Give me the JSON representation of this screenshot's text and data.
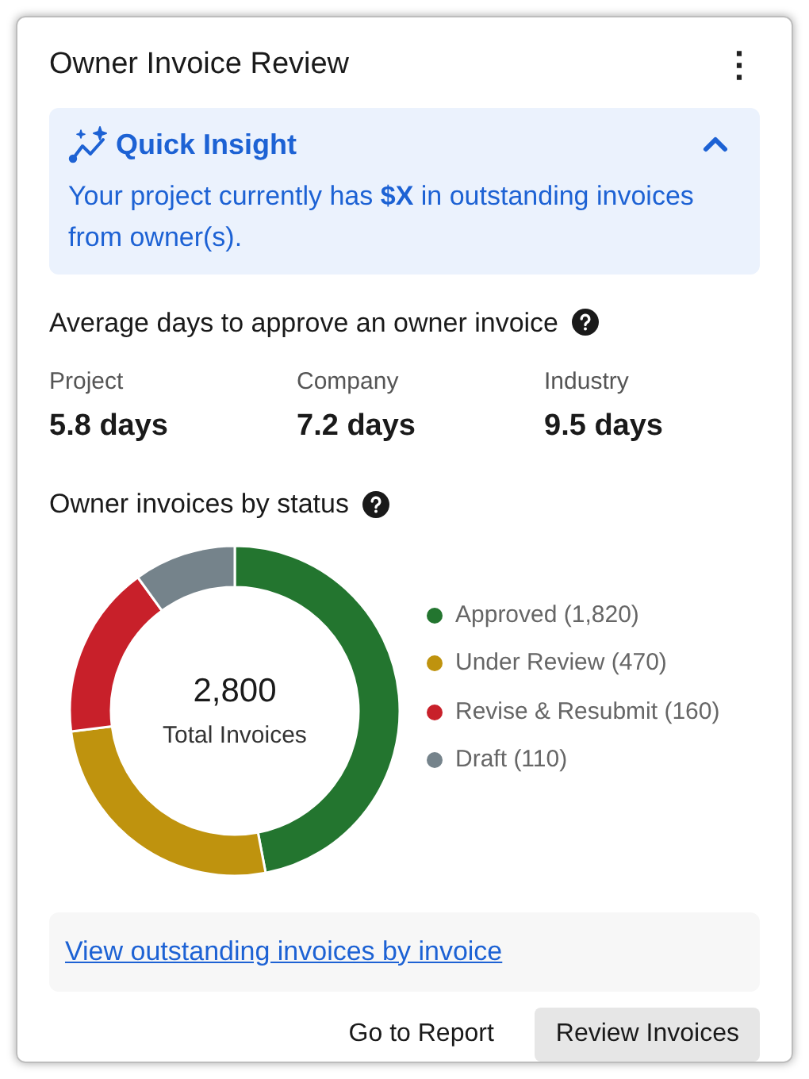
{
  "card": {
    "title": "Owner Invoice Review",
    "menu_icon": "⋮"
  },
  "insight": {
    "title": "Quick Insight",
    "expanded": true,
    "text": "Your project currently has **$X** in outstanding invoices from owner(s)."
  },
  "average": {
    "title": "Average days to approve an owner invoice",
    "stats": [
      {
        "label": "Project",
        "value": "5.8 days"
      },
      {
        "label": "Company",
        "value": "7.2 days"
      },
      {
        "label": "Industry",
        "value": "9.5 days"
      }
    ]
  },
  "status": {
    "title": "Owner invoices by status",
    "total": "2,800",
    "total_label": "Total Invoices",
    "chart_data": {
      "type": "donut",
      "categories": [
        "Approved",
        "Under Review",
        "Revise & Resubmit",
        "Draft"
      ],
      "series": [
        {
          "values": [
            47,
            26,
            17,
            10
          ]
        }
      ],
      "legend": "right",
      "value_labels": [
        "(1,820)",
        "(470)",
        "(160)",
        "(110)"
      ],
      "colors": [
        "#23752f",
        "#bf930e",
        "#c8202a",
        "#75838b"
      ]
    }
  },
  "link": "View outstanding invoices by invoice",
  "buttons": [
    {
      "label": "Go to Report",
      "kind": "text"
    },
    {
      "label": "Review Invoices",
      "kind": "filled"
    }
  ]
}
